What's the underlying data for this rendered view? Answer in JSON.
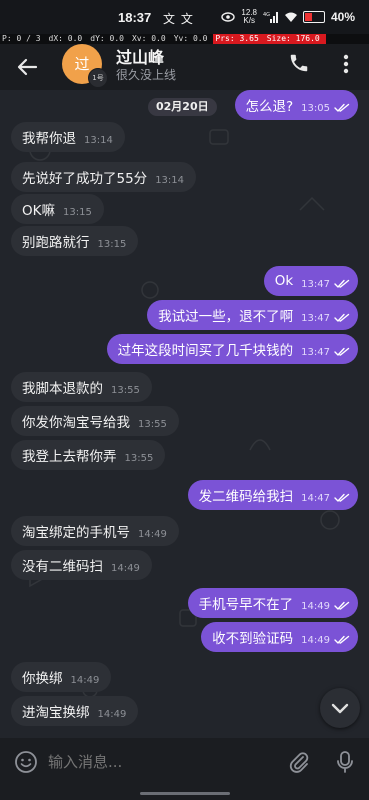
{
  "status_bar": {
    "time": "18:37",
    "time_icons": "文 文",
    "net_speed_value": "12.8",
    "net_speed_unit": "K/s",
    "signal_label": "4G",
    "battery_percent": "40%"
  },
  "debug_overlay": {
    "p": "P: 0 / 3",
    "dx": "dX: 0.0",
    "dy": "dY: 0.0",
    "xv": "Xv: 0.0",
    "yv": "Yv: 0.0",
    "prs": "Prs: 3.65",
    "size": "Size: 176.0"
  },
  "header": {
    "avatar_text": "过",
    "avatar_badge": "1号",
    "contact_name": "过山峰",
    "contact_status": "很久没上线"
  },
  "chat": {
    "date_label": "02月20日",
    "messages": [
      {
        "dir": "out",
        "text": "怎么退?",
        "time": "13:05"
      },
      {
        "dir": "in",
        "text": "我帮你退",
        "time": "13:14"
      },
      {
        "dir": "in",
        "text": "先说好了成功了55分",
        "time": "13:14"
      },
      {
        "dir": "in",
        "text": "OK嘛",
        "time": "13:15"
      },
      {
        "dir": "in",
        "text": "别跑路就行",
        "time": "13:15"
      },
      {
        "dir": "out",
        "text": "Ok",
        "time": "13:47"
      },
      {
        "dir": "out",
        "text": "我试过一些，退不了啊",
        "time": "13:47"
      },
      {
        "dir": "out",
        "text": "过年这段时间买了几千块钱的",
        "time": "13:47"
      },
      {
        "dir": "in",
        "text": "我脚本退款的",
        "time": "13:55"
      },
      {
        "dir": "in",
        "text": "你发你淘宝号给我",
        "time": "13:55"
      },
      {
        "dir": "in",
        "text": "我登上去帮你弄",
        "time": "13:55"
      },
      {
        "dir": "out",
        "text": "发二维码给我扫",
        "time": "14:47"
      },
      {
        "dir": "in",
        "text": "淘宝绑定的手机号",
        "time": "14:49"
      },
      {
        "dir": "in",
        "text": "没有二维码扫",
        "time": "14:49"
      },
      {
        "dir": "out",
        "text": "手机号早不在了",
        "time": "14:49"
      },
      {
        "dir": "out",
        "text": "收不到验证码",
        "time": "14:49"
      },
      {
        "dir": "in",
        "text": "你换绑",
        "time": "14:49"
      },
      {
        "dir": "in",
        "text": "进淘宝换绑",
        "time": "14:49"
      }
    ]
  },
  "composer": {
    "placeholder": "输入消息..."
  },
  "colors": {
    "outgoing_bubble": "#7b53d6",
    "incoming_bubble": "#2d3036",
    "avatar": "#f1a14a",
    "background": "#22252b"
  }
}
